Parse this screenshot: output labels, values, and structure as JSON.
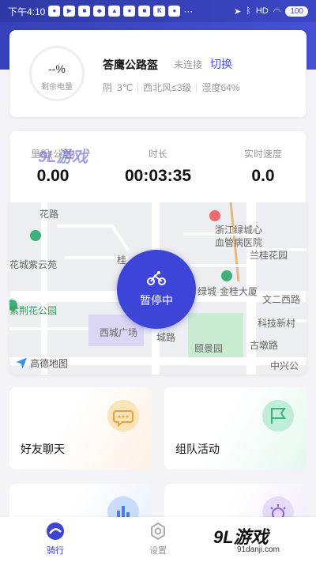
{
  "status_bar": {
    "time": "下午4:10",
    "signal_text": "HD",
    "battery": "100"
  },
  "device": {
    "battery_value": "--%",
    "battery_label": "剩余电量",
    "name": "答鹰公路盔",
    "status": "未连接",
    "switch_label": "切换",
    "weather": {
      "condition": "阴",
      "temperature": "3℃",
      "wind": "西北风≤3级",
      "humidity": "湿度64%"
    }
  },
  "ride": {
    "stats": [
      {
        "label": "里程(公里)",
        "value": "0.00"
      },
      {
        "label": "时长",
        "value": "00:03:35"
      },
      {
        "label": "实时速度",
        "value": "0.0"
      }
    ],
    "pause_label": "暂停中",
    "map": {
      "labels": [
        "花路",
        "浙江绿城心",
        "血管病医院",
        "兰桂花园",
        "花城紫云苑",
        "桂",
        "紫荆花公园",
        "绿城·金桂大厦",
        "文二西路",
        "西城广场",
        "城路",
        "科技新村",
        "颐景园",
        "古墩路",
        "中兴公"
      ],
      "provider": "高德地图"
    }
  },
  "features": [
    {
      "label": "好友聊天",
      "icon": "chat-icon"
    },
    {
      "label": "组队活动",
      "icon": "flag-icon"
    },
    {
      "label": "",
      "icon": "stats-icon"
    },
    {
      "label": "",
      "icon": "more-icon"
    }
  ],
  "nav": {
    "ride_label": "骑行",
    "settings_label": "设置"
  },
  "watermark": {
    "main": "9L游戏",
    "sub": "91danji.com",
    "top": "9L游戏"
  },
  "colors": {
    "accent": "#3d44d8",
    "header": "#3b46c4"
  }
}
